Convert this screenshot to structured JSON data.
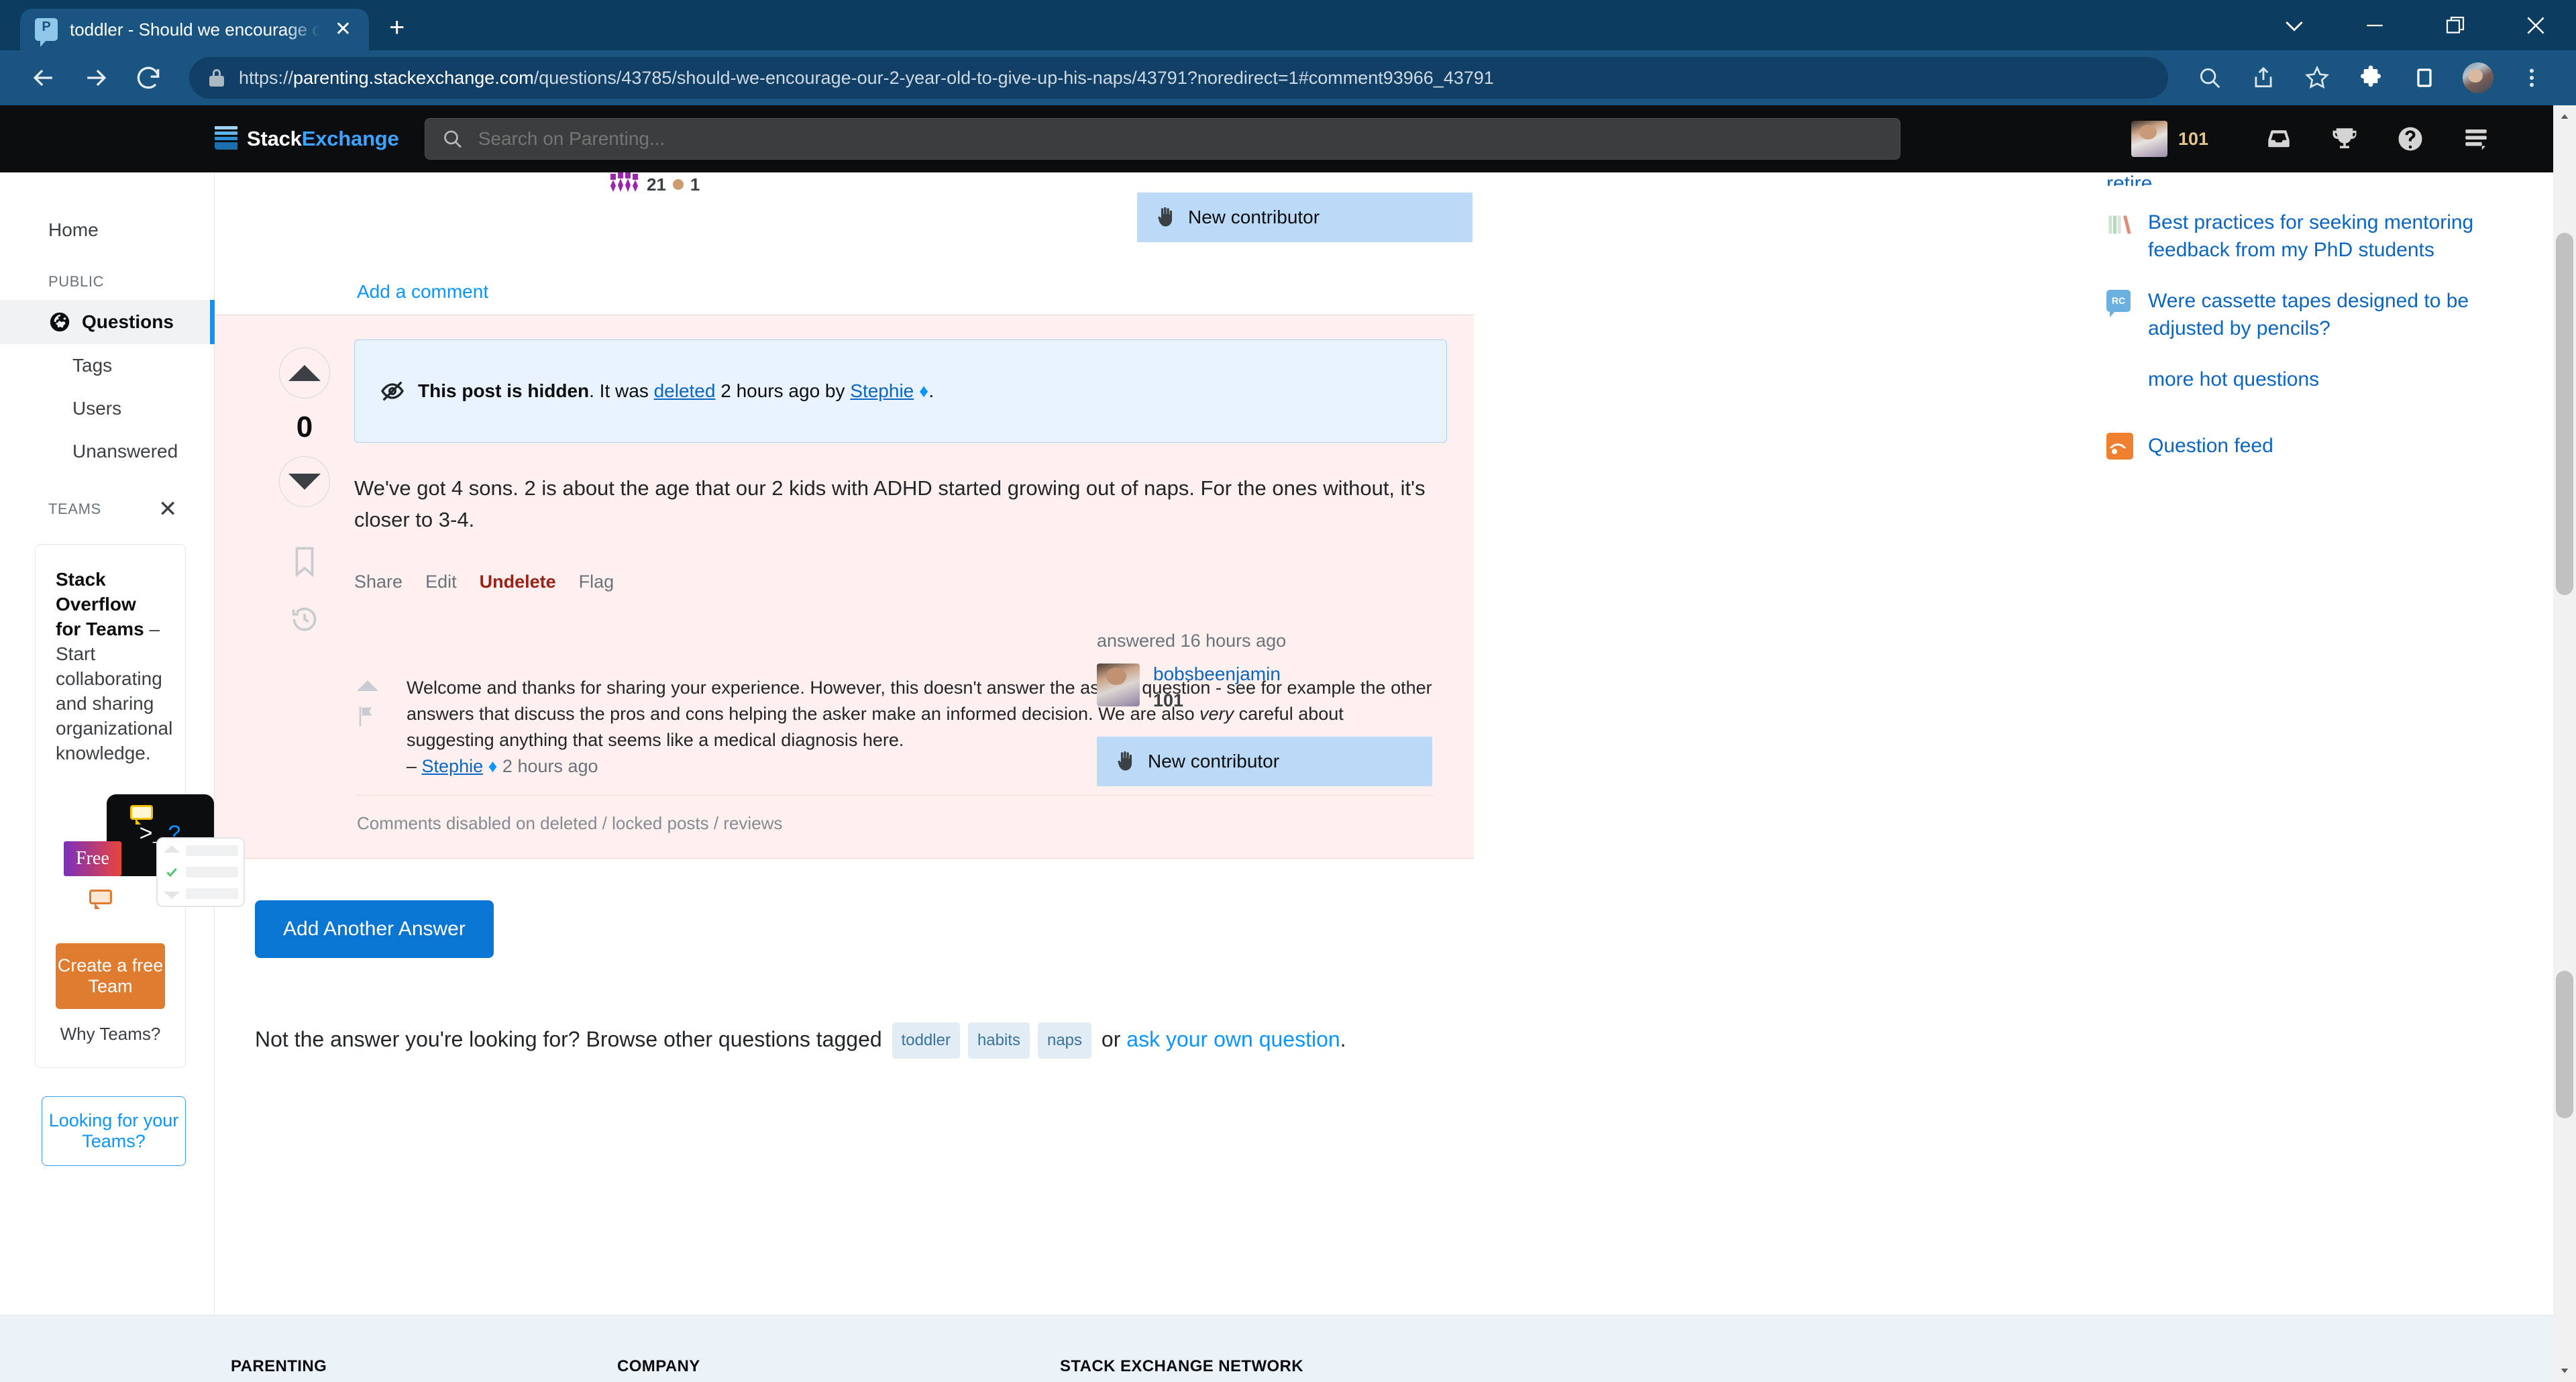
{
  "browser": {
    "tab": {
      "title": "toddler - Should we encourage o",
      "favicon": "parenting-stackexchange-favicon",
      "close": "✕"
    },
    "newtab_label": "+",
    "window": {
      "minimize": "—",
      "restore": "❐",
      "close": "✕",
      "expand": "∨"
    },
    "nav": {
      "back": "←",
      "forward": "→",
      "reload": "↻"
    },
    "url": {
      "scheme": "https://",
      "host": "parenting.stackexchange.com",
      "path": "/questions/43785/should-we-encourage-our-2-year-old-to-give-up-his-naps/43791?noredirect=1#comment93966_43791",
      "full": "https://parenting.stackexchange.com/questions/43785/should-we-encourage-our-2-year-old-to-give-up-his-naps/43791?noredirect=1#comment93966_43791"
    },
    "toolbar_icons": [
      "search-icon",
      "share-icon",
      "bookmark-star-icon",
      "extensions-puzzle-icon",
      "sidebar-panel-icon",
      "profile-avatar",
      "menu-kebab-icon"
    ]
  },
  "site": {
    "logo": {
      "stack": "Stack",
      "exchange": "Exchange"
    },
    "search": {
      "placeholder": "Search on Parenting...",
      "value": ""
    },
    "user": {
      "reputation": "101"
    },
    "header_icons": [
      "inbox-icon",
      "trophy-achievements-icon",
      "help-icon",
      "site-switcher-icon"
    ]
  },
  "sidebar": {
    "home": "Home",
    "public_label": "PUBLIC",
    "public_items": [
      {
        "label": "Questions",
        "icon": "globe-icon",
        "active": true
      },
      {
        "label": "Tags",
        "active": false
      },
      {
        "label": "Users",
        "active": false
      },
      {
        "label": "Unanswered",
        "active": false
      }
    ],
    "teams_label": "TEAMS",
    "teams_close": "✕",
    "teams_card": {
      "title_bold": "Stack Overflow for Teams",
      "title_rest": " – Start collaborating and sharing organizational knowledge.",
      "art": {
        "prompt": ">_",
        "question": "?",
        "free_badge": "Free"
      },
      "cta": "Create a free Team",
      "why": "Why Teams?"
    },
    "looking_for_teams": "Looking for your Teams?"
  },
  "previous_answer": {
    "rep": "21",
    "bronze_badges": "1",
    "new_contributor": "New contributor",
    "add_comment": "Add a comment"
  },
  "deleted_answer": {
    "vote_count": "0",
    "upvote_icon": "upvote-arrow-icon",
    "downvote_icon": "downvote-arrow-icon",
    "bookmark_icon": "bookmark-icon",
    "history_icon": "post-history-icon",
    "notice": {
      "icon": "hidden-eye-slash-icon",
      "bold": "This post is hidden",
      "text_1": ". It was ",
      "link": "deleted",
      "text_2": " 2 hours ago by ",
      "user": "Stephie",
      "diamond": "♦",
      "text_3": "."
    },
    "body": "We've got 4 sons. 2 is about the age that our 2 kids with ADHD started growing out of naps. For the ones without, it's closer to 3-4.",
    "actions": [
      {
        "label": "Share",
        "style": "muted"
      },
      {
        "label": "Edit",
        "style": "muted"
      },
      {
        "label": "Undelete",
        "style": "danger"
      },
      {
        "label": "Flag",
        "style": "muted"
      }
    ],
    "signature": {
      "time": "answered 16 hours ago",
      "user": "bobsbeenjamin",
      "rep": "101",
      "badge": "New contributor"
    },
    "comment": {
      "text_before_em": "Welcome and thanks for sharing your experience. However, this doesn't answer the asker's question - see for example the other answers that discuss the pros and cons helping the asker make an informed decision. We are also ",
      "emphasis": "very",
      "text_after_em": " careful about suggesting anything that seems like a medical diagnosis here.",
      "dash": "– ",
      "author": "Stephie",
      "diamond": "♦",
      "ago": "2 hours ago"
    },
    "comments_disabled": "Comments disabled on deleted / locked posts / reviews"
  },
  "bottom": {
    "add_another_answer": "Add Another Answer",
    "not_answer_prefix": "Not the answer you're looking for? Browse other questions tagged",
    "tags": [
      "toddler",
      "habits",
      "naps"
    ],
    "or": "or",
    "ask_link": "ask your own question",
    "period": "."
  },
  "right_sidebar": {
    "cut_off_text": "retire.",
    "hot_questions": [
      {
        "icon": "academia-stackexchange-icon",
        "title": "Best practices for seeking mentoring feedback from my PhD students"
      },
      {
        "icon": "retrocomputing-stackexchange-icon",
        "title": "Were cassette tapes designed to be adjusted by pencils?"
      }
    ],
    "more_hot": "more hot questions",
    "question_feed": "Question feed",
    "rss_icon": "rss-feed-icon"
  },
  "footer": {
    "columns": [
      "PARENTING",
      "COMPANY",
      "STACK EXCHANGE NETWORK"
    ]
  },
  "colors": {
    "chrome_frame": "#0d3c61",
    "chrome_toolbar": "#1a5480",
    "se_topbar": "#0c0d0e",
    "se_accent": "#0a95ff",
    "deleted_bg": "#fdf0ef",
    "notice_bg": "#e8f3fd",
    "new_contributor_bg": "#badaf7",
    "tag_bg": "#e1ecf4",
    "tag_fg": "#39739d",
    "teams_orange": "#e07c30",
    "undelete_red": "#9a2217",
    "footer_bg": "#ebf2f8"
  }
}
